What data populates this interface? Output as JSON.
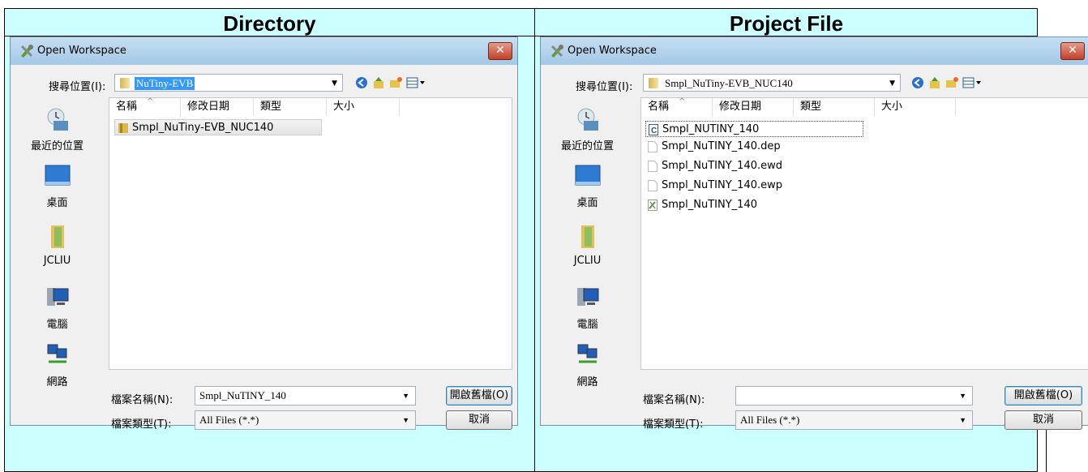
{
  "headers": {
    "left": "Directory",
    "right": "Project File"
  },
  "left": {
    "title": "Open Workspace",
    "close": "✕",
    "lookin_label": "搜尋位置(I):",
    "lookin_value": "NuTiny-EVB",
    "columns": [
      "名稱",
      "修改日期",
      "類型",
      "大小"
    ],
    "files": [
      {
        "name": "Smpl_NuTiny-EVB_NUC140",
        "icon": "folder-icon"
      }
    ],
    "places": [
      "最近的位置",
      "桌面",
      "JCLIU",
      "電腦",
      "網路"
    ],
    "filename_label": "檔案名稱(N):",
    "filename_value": "Smpl_NuTINY_140",
    "filetype_label": "檔案類型(T):",
    "filetype_value": "All Files (*.*)",
    "open_button": "開啟舊檔(O)",
    "cancel_button": "取消"
  },
  "right": {
    "title": "Open Workspace",
    "close": "✕",
    "lookin_label": "搜尋位置(I):",
    "lookin_value": "Smpl_NuTiny-EVB_NUC140",
    "columns": [
      "名稱",
      "修改日期",
      "類型",
      "大小"
    ],
    "files": [
      {
        "name": "Smpl_NUTINY_140",
        "icon": "c-source-icon"
      },
      {
        "name": "Smpl_NuTINY_140.dep",
        "icon": "file-icon"
      },
      {
        "name": "Smpl_NuTINY_140.ewd",
        "icon": "file-icon"
      },
      {
        "name": "Smpl_NuTINY_140.ewp",
        "icon": "file-icon"
      },
      {
        "name": "Smpl_NuTINY_140",
        "icon": "workspace-icon"
      }
    ],
    "places": [
      "最近的位置",
      "桌面",
      "JCLIU",
      "電腦",
      "網路"
    ],
    "filename_label": "檔案名稱(N):",
    "filename_value": "",
    "filetype_label": "檔案類型(T):",
    "filetype_value": "All Files (*.*)",
    "open_button": "開啟舊檔(O)",
    "cancel_button": "取消"
  }
}
